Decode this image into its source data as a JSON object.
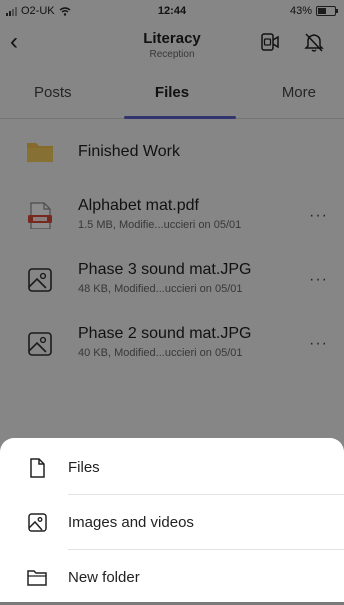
{
  "status_bar": {
    "carrier": "O2-UK",
    "time": "12:44",
    "battery": "43%"
  },
  "header": {
    "title": "Literacy",
    "subtitle": "Reception"
  },
  "tabs": [
    {
      "label": "Posts"
    },
    {
      "label": "Files"
    },
    {
      "label": "More"
    }
  ],
  "files": [
    {
      "name": "Finished Work",
      "icon": "folder-icon"
    },
    {
      "name": "Alphabet mat.pdf",
      "meta": "1.5 MB, Modifie...uccieri on 05/01",
      "icon": "pdf-file-icon"
    },
    {
      "name": "Phase 3 sound mat.JPG",
      "meta": "48 KB, Modified...uccieri on 05/01",
      "icon": "image-file-icon"
    },
    {
      "name": "Phase 2 sound mat.JPG",
      "meta": "40 KB, Modified...uccieri on 05/01",
      "icon": "image-file-icon"
    }
  ],
  "more_glyph": "···",
  "sheet": {
    "items": [
      {
        "label": "Files",
        "icon": "file-icon"
      },
      {
        "label": "Images and videos",
        "icon": "image-icon"
      },
      {
        "label": "New folder",
        "icon": "folder-icon"
      }
    ]
  },
  "colors": {
    "accent": "#5b5fc7",
    "folder": "#f2c14e",
    "pdf": "#d84b3a"
  }
}
